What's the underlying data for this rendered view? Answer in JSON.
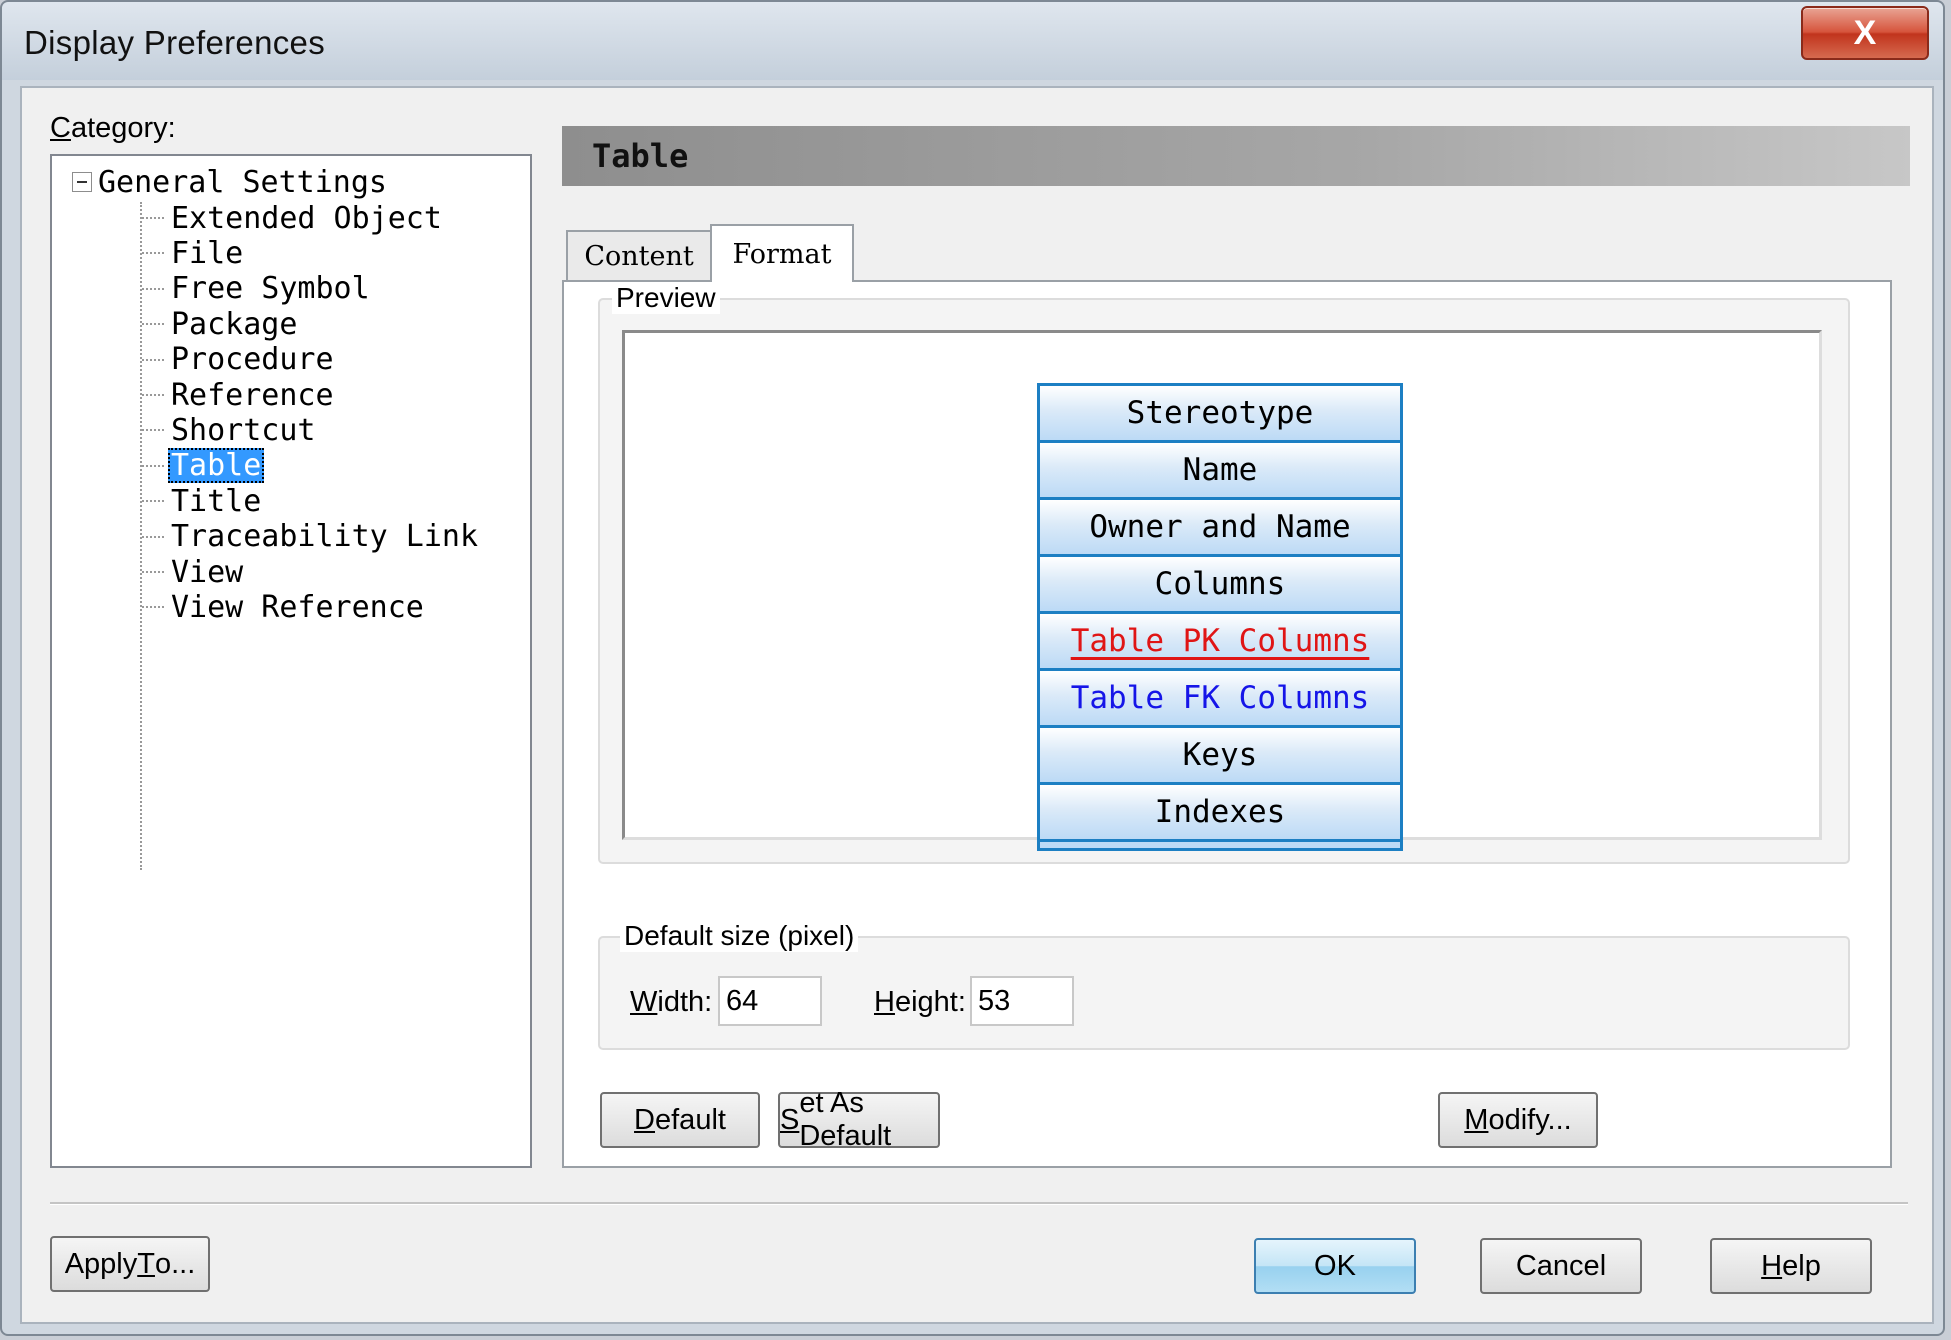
{
  "window": {
    "title": "Display Preferences",
    "close_label": "X"
  },
  "category": {
    "label": "Category:",
    "tree": {
      "root": "General Settings",
      "items": [
        "Extended Object",
        "File",
        "Free Symbol",
        "Package",
        "Procedure",
        "Reference",
        "Shortcut",
        "Table",
        "Title",
        "Traceability Link",
        "View",
        "View Reference"
      ],
      "selected": "Table"
    }
  },
  "panel": {
    "header": "Table",
    "tabs": [
      {
        "label": "Content",
        "active": false
      },
      {
        "label": "Format",
        "active": true
      }
    ]
  },
  "preview": {
    "group_label": "Preview",
    "symbol_rows": [
      {
        "text": "Stereotype",
        "style": "normal"
      },
      {
        "text": "Name",
        "style": "normal"
      },
      {
        "text": "Owner and Name",
        "style": "normal"
      },
      {
        "text": "Columns",
        "style": "normal"
      },
      {
        "text": "Table PK Columns",
        "style": "pk"
      },
      {
        "text": "Table FK Columns",
        "style": "fk"
      },
      {
        "text": "Keys",
        "style": "normal"
      },
      {
        "text": "Indexes",
        "style": "normal"
      }
    ],
    "colors": {
      "border": "#1c7fc3",
      "pk": "#e01515",
      "fk": "#1515e8"
    }
  },
  "default_size": {
    "group_label": "Default size (pixel)",
    "width_label": "Width:",
    "width_value": "64",
    "height_label": "Height:",
    "height_value": "53"
  },
  "buttons": {
    "default": "Default",
    "set_as_default": "Set As Default",
    "modify": "Modify...",
    "apply_to": "Apply To...",
    "ok": "OK",
    "cancel": "Cancel",
    "help": "Help"
  }
}
